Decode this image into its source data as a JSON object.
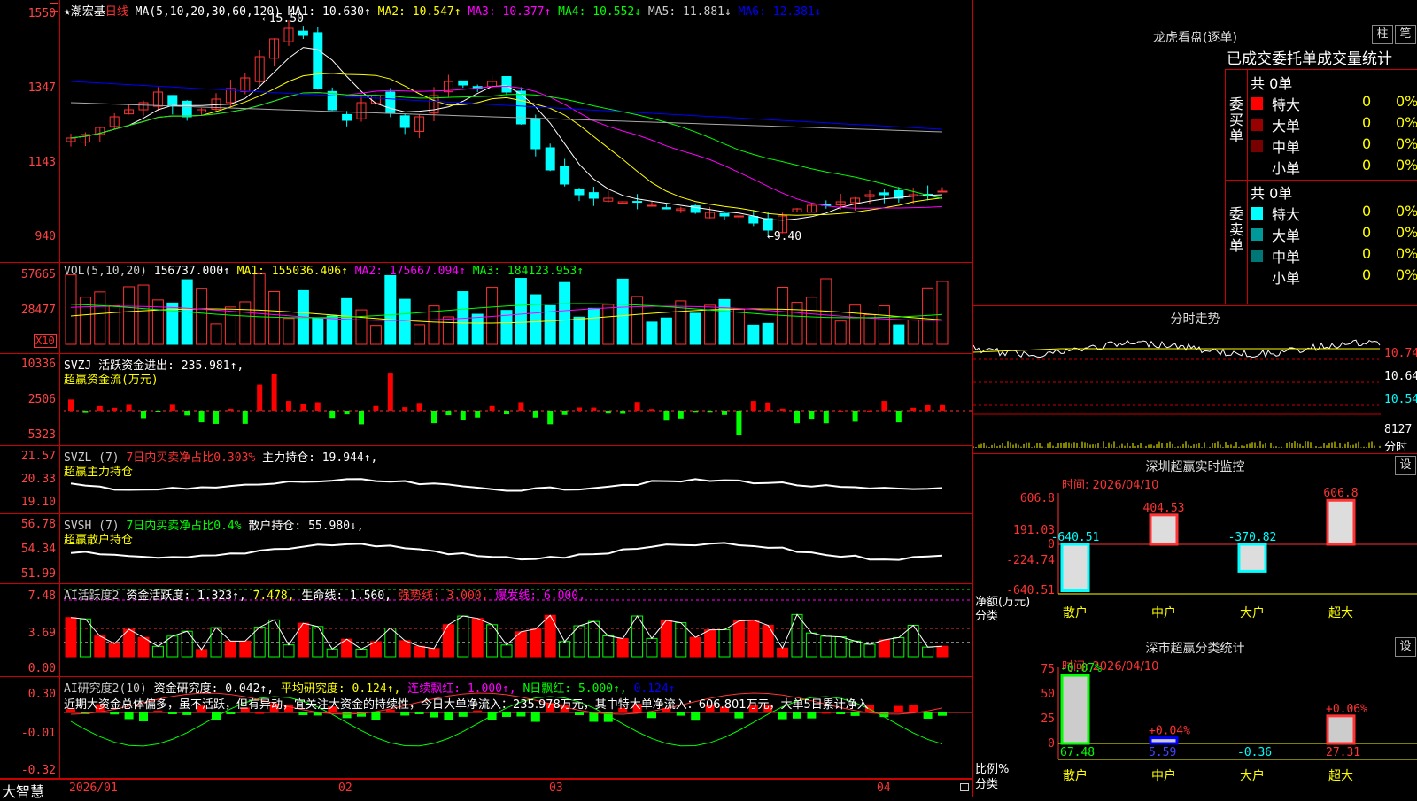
{
  "colors": {
    "up": "#ff3232",
    "down": "#00ffff",
    "ma1": "#ffffff",
    "ma2": "#ffff00",
    "ma3": "#ff00ff",
    "ma4": "#00ff00",
    "ma5": "#aaaaaa",
    "ma6": "#0000ff"
  },
  "main": {
    "stock": "★潮宏基",
    "period": "日线",
    "ma_label": "MA(5,10,20,30,60,120)",
    "ma": [
      {
        "label": "MA1: 10.630↑",
        "color": "#fff"
      },
      {
        "label": "MA2: 10.547↑",
        "color": "#ff0"
      },
      {
        "label": "MA3: 10.377↑",
        "color": "#f0f"
      },
      {
        "label": "MA4: 10.552↓",
        "color": "#0f0"
      },
      {
        "label": "MA5: 11.881↓",
        "color": "#ccc"
      },
      {
        "label": "MA6: 12.381↓",
        "color": "#00f"
      }
    ],
    "ticks": [
      "1550",
      "1347",
      "1143",
      "940"
    ],
    "high_label": "15.50",
    "low_label": "9.40"
  },
  "vol": {
    "header": "VOL(5,10,20)",
    "value": "156737.000↑",
    "ma": [
      {
        "label": "MA1: 155036.406↑",
        "color": "#ff0"
      },
      {
        "label": "MA2: 175667.094↑",
        "color": "#f0f"
      },
      {
        "label": "MA3: 184123.953↑",
        "color": "#0f0"
      }
    ],
    "ticks": [
      "57665",
      "28477"
    ],
    "unit": "X10"
  },
  "svzj": {
    "header": "SVZJ  活跃资金进出: 235.981↑,",
    "subtitle": "超赢资金流(万元)",
    "ticks": [
      "10336",
      "2506",
      "-5323"
    ]
  },
  "svzl": {
    "name": "SVZL (7)",
    "desc": "7日内买卖净占比0.303%",
    "main": "主力持仓: 19.944↑,",
    "subtitle": "超赢主力持仓",
    "ticks": [
      "21.57",
      "20.33",
      "19.10"
    ]
  },
  "svsh": {
    "name": "SVSH (7)",
    "desc": "7日内买卖净占比0.4%",
    "main": "散户持仓: 55.980↓,",
    "subtitle": "超赢散户持仓",
    "ticks": [
      "56.78",
      "54.34",
      "51.99"
    ]
  },
  "ai1": {
    "name": "AI活跃度2",
    "a": "资金活跃度: 1.323↑,",
    "b": "7.478,",
    "c": "生命线: 1.560,",
    "d": "强势线: 3.000,",
    "e": "爆发线: 6.000,",
    "ticks": [
      "7.48",
      "3.69",
      "0.00"
    ]
  },
  "ai2": {
    "name": "AI研究度2(10)",
    "a": "资金研究度: 0.042↑,",
    "b": "平均研究度: 0.124↑,",
    "c": "连续飘红: 1.000↑,",
    "d": "N日飘红: 5.000↑,",
    "e": "0.124↑",
    "comment": "近期大资金总体偏多，虽不活跃，但有异动，宜关注大资金的持续性，今日大单净流入：235.978万元，其中特大单净流入：606.801万元，大单5日累计净入",
    "ticks": [
      "0.30",
      "-0.01",
      "-0.32"
    ]
  },
  "dates": [
    "2026/01",
    "02",
    "03",
    "04"
  ],
  "brand": "大智慧",
  "lhb": {
    "title": "龙虎看盘(逐单)",
    "btn1": "柱",
    "btn2": "笔",
    "tabs": "已成交委托单成交量统计",
    "buy": {
      "side": "委买单",
      "total": "共 0单",
      "rows": [
        {
          "name": "特大",
          "v": "0",
          "p": "0%",
          "c": "#f00"
        },
        {
          "name": "大单",
          "v": "0",
          "p": "0%",
          "c": "#900"
        },
        {
          "name": "中单",
          "v": "0",
          "p": "0%",
          "c": "#700"
        },
        {
          "name": "小单",
          "v": "0",
          "p": "0%",
          "c": ""
        }
      ]
    },
    "sell": {
      "side": "委卖单",
      "total": "共 0单",
      "rows": [
        {
          "name": "特大",
          "v": "0",
          "p": "0%",
          "c": "#0ff"
        },
        {
          "name": "大单",
          "v": "0",
          "p": "0%",
          "c": "#099"
        },
        {
          "name": "中单",
          "v": "0",
          "p": "0%",
          "c": "#077"
        },
        {
          "name": "小单",
          "v": "0",
          "p": "0%",
          "c": ""
        }
      ]
    }
  },
  "intraday": {
    "title": "分时走势",
    "ticks": [
      "10.74",
      "10.64",
      "10.54"
    ],
    "vol_tick": "8127",
    "vol_label": "分时"
  },
  "sz": {
    "title": "深圳超赢实时监控",
    "btn": "设",
    "time": "时间: 2026/04/10",
    "ticks": [
      "606.8",
      "191.03",
      "0",
      "-224.74",
      "-640.51"
    ],
    "bars": [
      {
        "label": "-640.51",
        "cat": "散户"
      },
      {
        "label": "404.53",
        "cat": "中户"
      },
      {
        "label": "-370.82",
        "cat": "大户"
      },
      {
        "label": "606.8",
        "cat": "超大"
      }
    ],
    "ylab": "净额(万元)",
    "xlab": "分类"
  },
  "sc": {
    "title": "深市超赢分类统计",
    "btn": "设",
    "time": "时间: 2026/04/10",
    "ticks": [
      "75",
      "50",
      "25",
      "0"
    ],
    "bars": [
      {
        "top": "-0.07%",
        "bot": "67.48",
        "cat": "散户"
      },
      {
        "top": "+0.04%",
        "bot": "5.59",
        "cat": "中户"
      },
      {
        "top": "",
        "bot": "-0.36",
        "cat": "大户"
      },
      {
        "top": "+0.06%",
        "bot": "27.31",
        "cat": "超大"
      }
    ],
    "ylab": "比例%",
    "xlab": "分类"
  }
}
